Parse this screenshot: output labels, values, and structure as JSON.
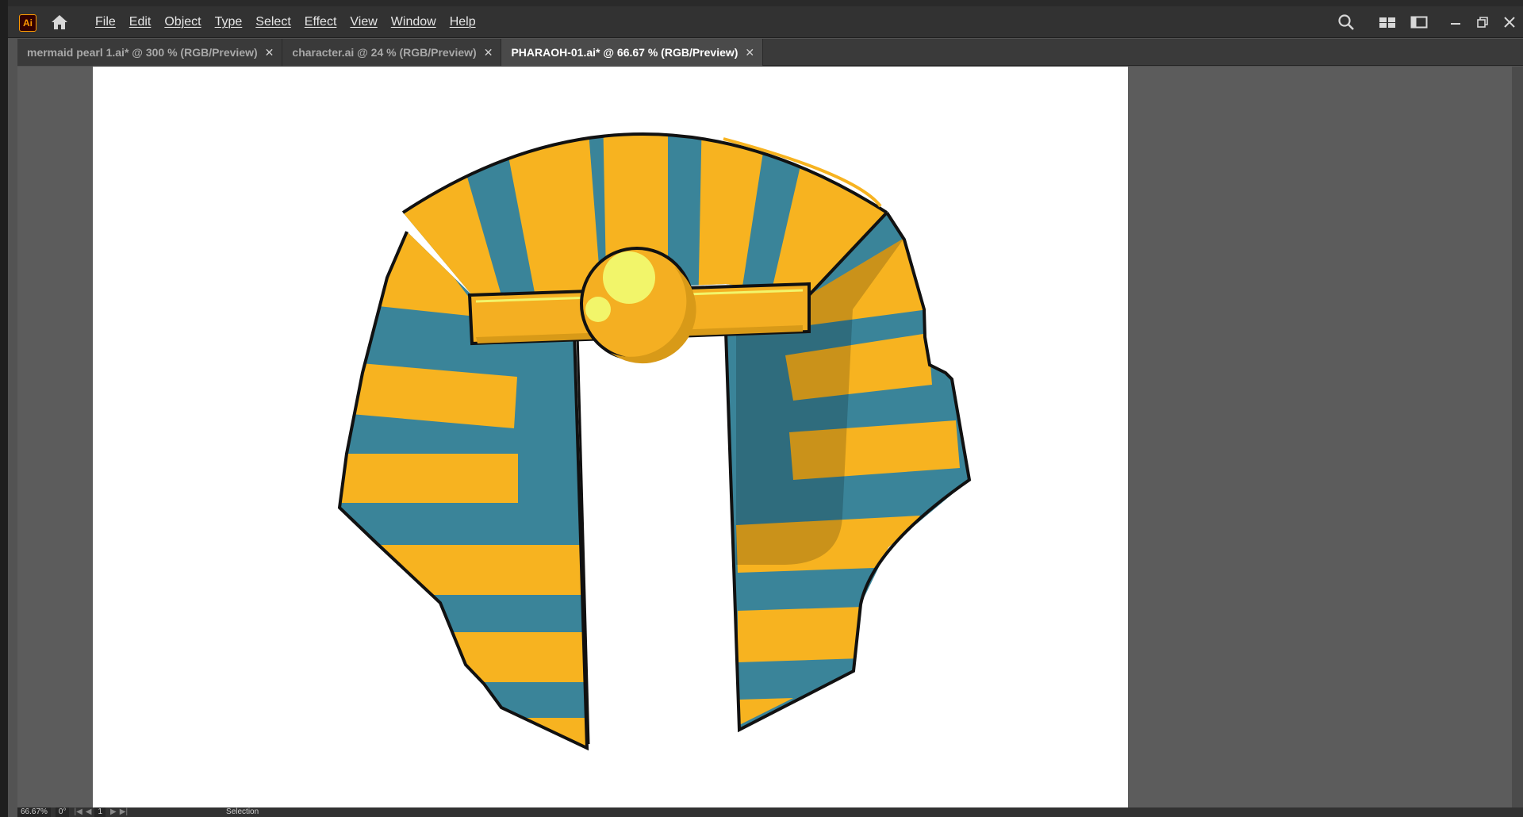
{
  "app": {
    "logo_text": "Ai"
  },
  "menu": {
    "items": [
      "File",
      "Edit",
      "Object",
      "Type",
      "Select",
      "Effect",
      "View",
      "Window",
      "Help"
    ]
  },
  "tabs": [
    {
      "label": "mermaid pearl 1.ai* @ 300 % (RGB/Preview)",
      "close": "✕",
      "active": false
    },
    {
      "label": "character.ai @ 24 % (RGB/Preview)",
      "close": "✕",
      "active": false
    },
    {
      "label": "PHARAOH-01.ai* @ 66.67 % (RGB/Preview)",
      "close": "✕",
      "active": true
    }
  ],
  "status": {
    "zoom": "66.67%",
    "rotation": "0°",
    "artboard": "1",
    "tool": "Selection"
  },
  "icons": [
    "home-icon",
    "search-icon",
    "arrange-documents-icon",
    "workspace-icon",
    "minimize-icon",
    "restore-icon",
    "close-icon"
  ],
  "colors": {
    "stripe_gold": "#F7B320",
    "stripe_teal": "#3A8499",
    "band_gold": "#F4AF22",
    "highlight": "#F2F56A",
    "outline": "#111111"
  }
}
